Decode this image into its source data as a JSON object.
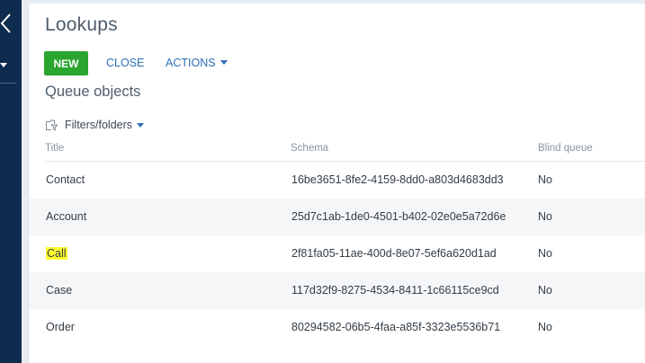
{
  "page": {
    "title": "Lookups",
    "section_title": "Queue objects"
  },
  "toolbar": {
    "new_label": "NEW",
    "close_label": "CLOSE",
    "actions_label": "ACTIONS"
  },
  "filters": {
    "label": "Filters/folders"
  },
  "table": {
    "columns": [
      "Title",
      "Schema",
      "Blind queue"
    ],
    "rows": [
      {
        "title": "Contact",
        "schema": "16be3651-8fe2-4159-8dd0-a803d4683dd3",
        "blind": "No"
      },
      {
        "title": "Account",
        "schema": "25d7c1ab-1de0-4501-b402-02e0e5a72d6e",
        "blind": "No"
      },
      {
        "title": "Call",
        "schema": "2f81fa05-11ae-400d-8e07-5ef6a620d1ad",
        "blind": "No",
        "highlighted": true
      },
      {
        "title": "Case",
        "schema": "117d32f9-8275-4534-8411-1c66115ce9cd",
        "blind": "No"
      },
      {
        "title": "Order",
        "schema": "80294582-06b5-4faa-a85f-3323e5536b71",
        "blind": "No"
      }
    ]
  },
  "colors": {
    "rail": "#0e2c4d",
    "new_button": "#2aa52f",
    "link": "#2c6fb6",
    "highlight": "#ffff2e"
  },
  "icons": {
    "back": "chevron-left-icon",
    "rail_menu": "caret-down-icon",
    "filters": "filter-folder-icon",
    "dropdown": "caret-down-icon"
  }
}
